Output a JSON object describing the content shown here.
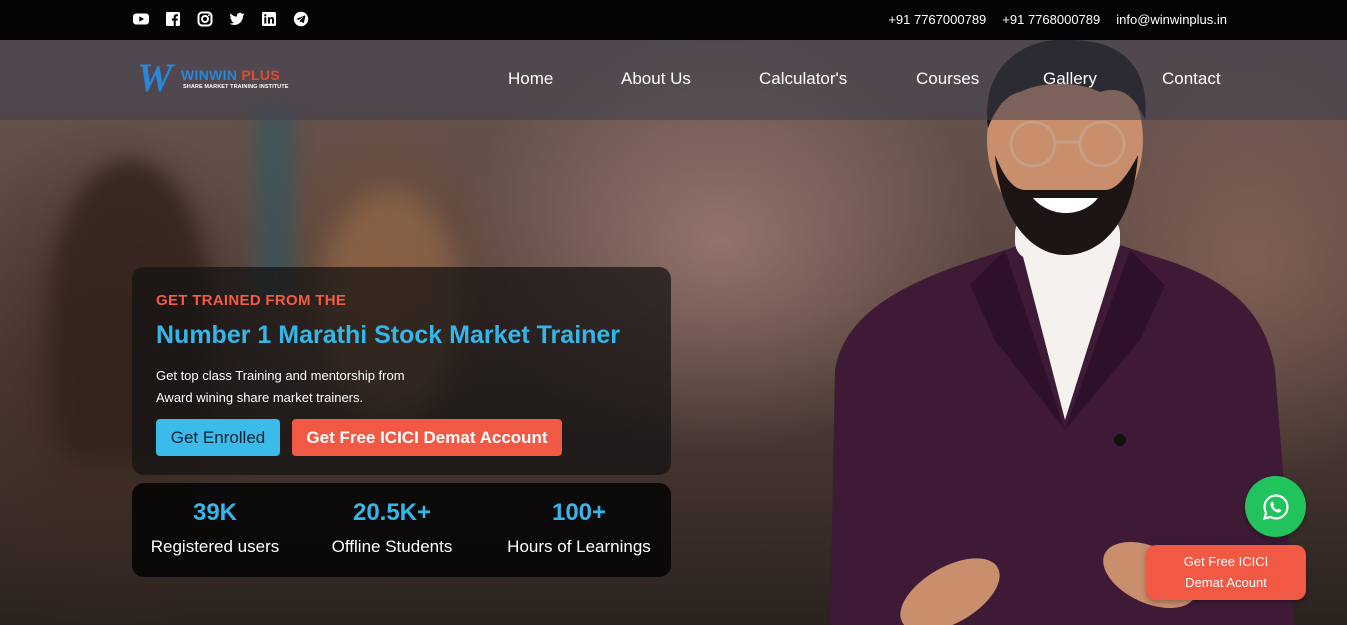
{
  "topbar": {
    "socials": [
      {
        "icon": "youtube-icon"
      },
      {
        "icon": "facebook-icon"
      },
      {
        "icon": "instagram-icon"
      },
      {
        "icon": "twitter-icon"
      },
      {
        "icon": "linkedin-icon"
      },
      {
        "icon": "telegram-icon"
      }
    ],
    "phone1": "+91 7767000789",
    "phone2": "+91 7768000789",
    "email": "info@winwinplus.in"
  },
  "brand": {
    "mark": "W",
    "name_part1": "WINWIN",
    "name_part2": " PLUS",
    "tagline": "SHARE MARKET TRAINING INSTITUTE",
    "colors": {
      "blue": "#2a86d6",
      "red": "#e14a37"
    }
  },
  "nav": {
    "items": [
      "Home",
      "About Us",
      "Calculator's",
      "Courses",
      "Gallery",
      "Contact"
    ]
  },
  "hero": {
    "eyebrow": "GET TRAINED FROM THE",
    "headline": "Number 1 Marathi Stock Market Trainer",
    "desc_line1": "Get top class Training and mentorship from",
    "desc_line2": "Award wining share market trainers.",
    "cta_primary": "Get Enrolled",
    "cta_secondary": "Get Free ICICI Demat Account"
  },
  "stats": [
    {
      "value": "39K",
      "label": "Registered users"
    },
    {
      "value": "20.5K+",
      "label": "Offline Students"
    },
    {
      "value": "100+",
      "label": "Hours of Learnings"
    }
  ],
  "floating": {
    "whatsapp_icon": "whatsapp-icon",
    "demat_line1": "Get Free ICICI",
    "demat_line2": "Demat Acount"
  },
  "colors": {
    "accent_blue": "#36b6e8",
    "accent_red": "#f25944",
    "whatsapp_green": "#21c45c"
  }
}
